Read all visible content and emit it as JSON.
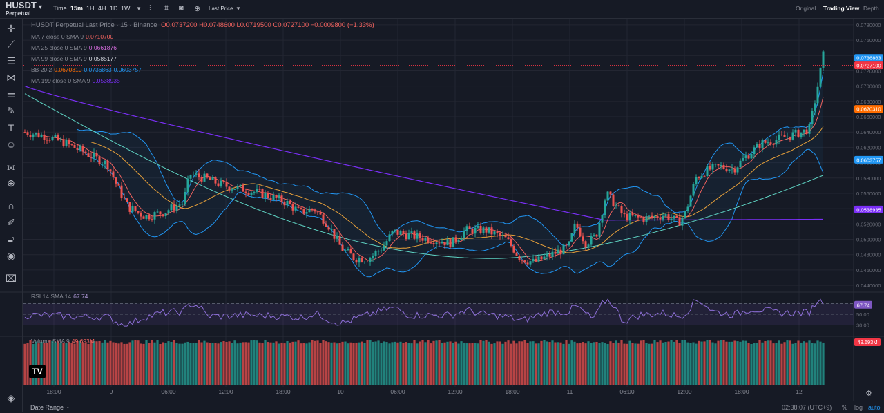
{
  "header": {
    "symbol": "HUSDT",
    "subtitle": "Perpetual",
    "intervals": [
      "Time",
      "15m",
      "1H",
      "4H",
      "1D",
      "1W"
    ],
    "active_interval": "15m",
    "price_type": "Last Price",
    "views": [
      "Original",
      "Trading View",
      "Depth"
    ],
    "active_view": "Trading View"
  },
  "legend": {
    "title": "HUSDT Perpetual Last Price · 15 · Binance",
    "ohlc": "O0.0737200 H0.0748600 L0.0719500 C0.0727100 −0.0009800 (−1.33%)",
    "ma7_label": "MA 7 close 0 SMA 9",
    "ma7_value": "0.0710700",
    "ma25_label": "MA 25 close 0 SMA 9",
    "ma25_value": "0.0661876",
    "ma99_label": "MA 99 close 0 SMA 9",
    "ma99_value": "0.0585177",
    "bb_label": "BB 20 2",
    "bb_basis": "0.0670310",
    "bb_upper": "0.0736863",
    "bb_lower": "0.0603757",
    "ma199_label": "MA 199 close 0 SMA 9",
    "ma199_value": "0.0538935",
    "rsi_label": "RSI 14 SMA 14",
    "rsi_value": "67.74",
    "vol_label": "Volume SMA 9",
    "vol_value": "49.693M"
  },
  "price_axis": {
    "ticks": [
      "0.0780000",
      "0.0760000",
      "0.0740000",
      "0.0720000",
      "0.0700000",
      "0.0680000",
      "0.0660000",
      "0.0640000",
      "0.0620000",
      "0.0600000",
      "0.0580000",
      "0.0560000",
      "0.0540000",
      "0.0520000",
      "0.0500000",
      "0.0480000",
      "0.0460000",
      "0.0440000"
    ],
    "tags": [
      {
        "text": "0.0736863",
        "color": "#2196f3"
      },
      {
        "text": "0.0727100",
        "color": "#f23645"
      },
      {
        "text": "0.0670310",
        "color": "#ff6d00"
      },
      {
        "text": "0.0603757",
        "color": "#2196f3"
      },
      {
        "text": "0.0538935",
        "color": "#7b2ff7"
      }
    ]
  },
  "rsi_axis": {
    "ticks": [
      "70.00",
      "50.00",
      "30.00"
    ],
    "tag": "67.74"
  },
  "vol_axis": {
    "tag": "49.693M"
  },
  "time_axis": [
    "18:00",
    "9",
    "06:00",
    "12:00",
    "18:00",
    "10",
    "06:00",
    "12:00",
    "18:00",
    "11",
    "06:00",
    "12:00",
    "18:00",
    "12"
  ],
  "footer": {
    "date_range": "Date Range",
    "clock": "02:38:07 (UTC+9)",
    "pct": "%",
    "log": "log",
    "auto": "auto"
  },
  "colors": {
    "up": "#26a69a",
    "down": "#ef5350",
    "ma7": "#f0625e",
    "ma25": "#e8a13a",
    "ma99": "#5fd4c4",
    "bb": "#2196f3",
    "ma199": "#7b2ff7",
    "rsi": "#8e6fd8"
  },
  "chart_data": {
    "type": "candlestick",
    "price_range": [
      0.0432,
      0.0788
    ],
    "keypoints": [
      [
        0,
        0.064
      ],
      [
        30,
        0.0635
      ],
      [
        60,
        0.0625
      ],
      [
        90,
        0.0612
      ],
      [
        120,
        0.0598
      ],
      [
        135,
        0.0568
      ],
      [
        150,
        0.0542
      ],
      [
        175,
        0.053
      ],
      [
        200,
        0.0535
      ],
      [
        230,
        0.0548
      ],
      [
        240,
        0.0585
      ],
      [
        260,
        0.058
      ],
      [
        290,
        0.057
      ],
      [
        320,
        0.0565
      ],
      [
        350,
        0.0558
      ],
      [
        380,
        0.0548
      ],
      [
        400,
        0.0535
      ],
      [
        420,
        0.054
      ],
      [
        440,
        0.052
      ],
      [
        460,
        0.0488
      ],
      [
        480,
        0.0475
      ],
      [
        500,
        0.0475
      ],
      [
        520,
        0.049
      ],
      [
        535,
        0.051
      ],
      [
        560,
        0.0505
      ],
      [
        590,
        0.05
      ],
      [
        620,
        0.0495
      ],
      [
        640,
        0.0512
      ],
      [
        670,
        0.0512
      ],
      [
        700,
        0.05
      ],
      [
        720,
        0.0475
      ],
      [
        740,
        0.047
      ],
      [
        760,
        0.0478
      ],
      [
        790,
        0.049
      ],
      [
        800,
        0.052
      ],
      [
        815,
        0.0495
      ],
      [
        830,
        0.0505
      ],
      [
        845,
        0.056
      ],
      [
        870,
        0.053
      ],
      [
        900,
        0.0527
      ],
      [
        930,
        0.0532
      ],
      [
        950,
        0.0522
      ],
      [
        960,
        0.0535
      ],
      [
        975,
        0.058
      ],
      [
        990,
        0.059
      ],
      [
        1010,
        0.0595
      ],
      [
        1030,
        0.0592
      ],
      [
        1050,
        0.061
      ],
      [
        1070,
        0.0625
      ],
      [
        1090,
        0.063
      ],
      [
        1110,
        0.0635
      ],
      [
        1130,
        0.064
      ],
      [
        1140,
        0.0645
      ],
      [
        1150,
        0.069
      ],
      [
        1160,
        0.074
      ],
      [
        1164,
        0.0727
      ]
    ],
    "rsi_range": [
      10,
      90
    ],
    "rsi_levels": [
      70,
      50,
      30
    ],
    "rsi_last": 67.74,
    "volume_last": "49.693M"
  }
}
